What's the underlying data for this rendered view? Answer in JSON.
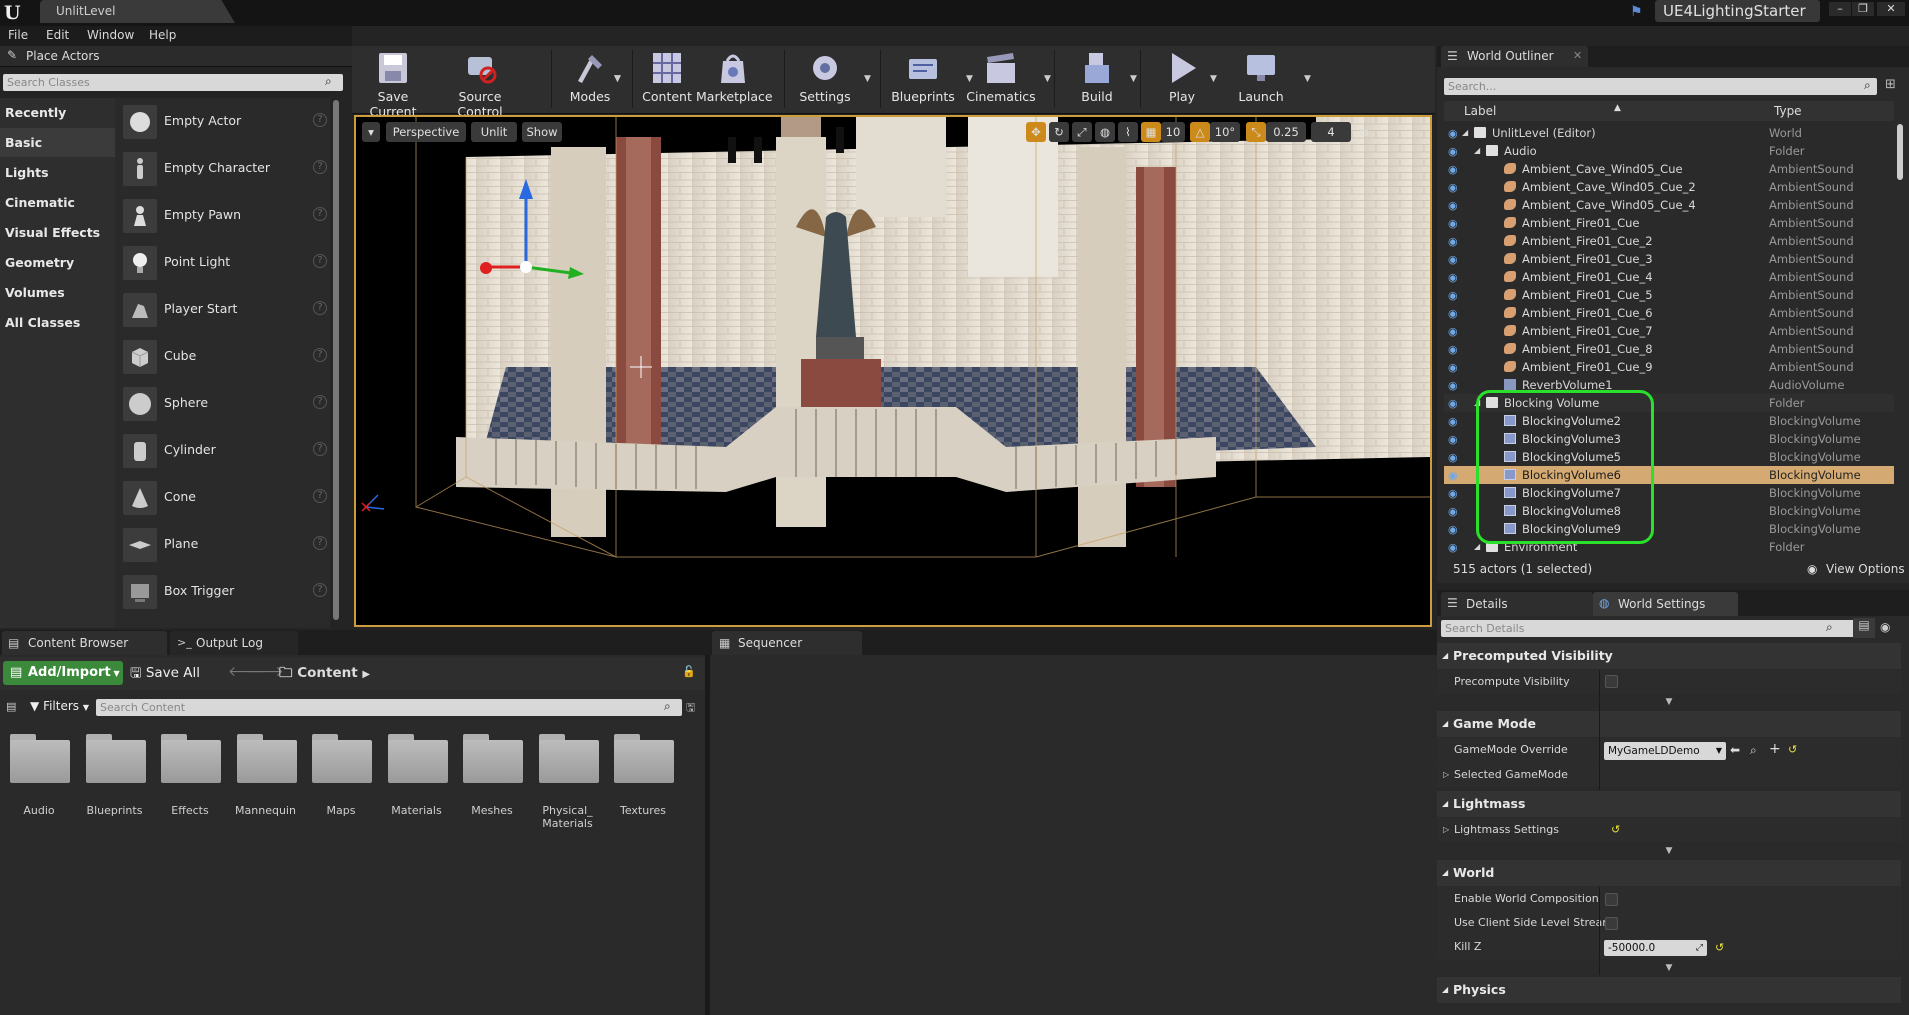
{
  "titlebar": {
    "doc_tab": "UnlitLevel",
    "project": "UE4LightingStarter"
  },
  "menu": [
    "File",
    "Edit",
    "Window",
    "Help"
  ],
  "place_actors": {
    "title": "Place Actors",
    "search_placeholder": "Search Classes",
    "categories": [
      "Recently Placed",
      "Basic",
      "Lights",
      "Cinematic",
      "Visual Effects",
      "Geometry",
      "Volumes",
      "All Classes"
    ],
    "selected_category": "Basic",
    "actors": [
      "Empty Actor",
      "Empty Character",
      "Empty Pawn",
      "Point Light",
      "Player Start",
      "Cube",
      "Sphere",
      "Cylinder",
      "Cone",
      "Plane",
      "Box Trigger"
    ]
  },
  "toolbar": {
    "items": [
      "Save Current",
      "Source Control",
      "Modes",
      "Content",
      "Marketplace",
      "Settings",
      "Blueprints",
      "Cinematics",
      "Build",
      "Play",
      "Launch"
    ]
  },
  "viewport": {
    "perspective": "Perspective",
    "view_mode": "Unlit",
    "show": "Show",
    "grid_snap": "10",
    "rot_snap": "10°",
    "scale_snap": "0.25",
    "camera_speed": "4"
  },
  "world_outliner": {
    "title": "World Outliner",
    "search_placeholder": "Search...",
    "col_label": "Label",
    "col_type": "Type",
    "rows": [
      {
        "label": "UnlitLevel (Editor)",
        "type": "World"
      },
      {
        "label": "Audio",
        "type": "Folder"
      },
      {
        "label": "Ambient_Cave_Wind05_Cue",
        "type": "AmbientSound"
      },
      {
        "label": "Ambient_Cave_Wind05_Cue_2",
        "type": "AmbientSound"
      },
      {
        "label": "Ambient_Cave_Wind05_Cue_4",
        "type": "AmbientSound"
      },
      {
        "label": "Ambient_Fire01_Cue",
        "type": "AmbientSound"
      },
      {
        "label": "Ambient_Fire01_Cue_2",
        "type": "AmbientSound"
      },
      {
        "label": "Ambient_Fire01_Cue_3",
        "type": "AmbientSound"
      },
      {
        "label": "Ambient_Fire01_Cue_4",
        "type": "AmbientSound"
      },
      {
        "label": "Ambient_Fire01_Cue_5",
        "type": "AmbientSound"
      },
      {
        "label": "Ambient_Fire01_Cue_6",
        "type": "AmbientSound"
      },
      {
        "label": "Ambient_Fire01_Cue_7",
        "type": "AmbientSound"
      },
      {
        "label": "Ambient_Fire01_Cue_8",
        "type": "AmbientSound"
      },
      {
        "label": "Ambient_Fire01_Cue_9",
        "type": "AmbientSound"
      },
      {
        "label": "ReverbVolume1",
        "type": "AudioVolume"
      },
      {
        "label": "Blocking Volume",
        "type": "Folder"
      },
      {
        "label": "BlockingVolume2",
        "type": "BlockingVolume"
      },
      {
        "label": "BlockingVolume3",
        "type": "BlockingVolume"
      },
      {
        "label": "BlockingVolume5",
        "type": "BlockingVolume"
      },
      {
        "label": "BlockingVolume6",
        "type": "BlockingVolume"
      },
      {
        "label": "BlockingVolume7",
        "type": "BlockingVolume"
      },
      {
        "label": "BlockingVolume8",
        "type": "BlockingVolume"
      },
      {
        "label": "BlockingVolume9",
        "type": "BlockingVolume"
      },
      {
        "label": "Environment",
        "type": "Folder"
      }
    ],
    "selected": "BlockingVolume6",
    "footer": "515 actors (1 selected)",
    "view_options": "View Options"
  },
  "details": {
    "tab_details": "Details",
    "tab_world_settings": "World Settings",
    "search_placeholder": "Search Details",
    "precomputed_visibility": "Precomputed Visibility",
    "precompute_visibility": "Precompute Visibility",
    "game_mode": "Game Mode",
    "gamemode_override": "GameMode Override",
    "gamemode_value": "MyGameLDDemo",
    "selected_gamemode": "Selected GameMode",
    "lightmass": "Lightmass",
    "lightmass_settings": "Lightmass Settings",
    "world": "World",
    "enable_world_composition": "Enable World Composition",
    "use_client_side": "Use Client Side Level Stream",
    "kill_z": "Kill Z",
    "kill_z_value": "-50000.0",
    "physics": "Physics"
  },
  "content_browser": {
    "tab": "Content Browser",
    "output_log": "Output Log",
    "add_import": "Add/Import",
    "save_all": "Save All",
    "path": "Content",
    "filters": "Filters",
    "search_placeholder": "Search Content",
    "folders": [
      "Audio",
      "Blueprints",
      "Effects",
      "Mannequin",
      "Maps",
      "Materials",
      "Meshes",
      "Physical_ Materials",
      "Textures"
    ]
  },
  "sequencer": {
    "tab": "Sequencer"
  },
  "colors": {
    "accent": "#cc9d3a",
    "selection": "#d4a972",
    "highlight": "#2ae02a",
    "add_button": "#3b8a3b"
  }
}
